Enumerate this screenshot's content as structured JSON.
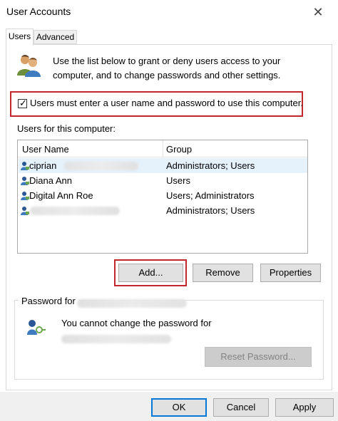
{
  "window": {
    "title": "User Accounts",
    "close_glyph": "✕"
  },
  "tabs": [
    {
      "label": "Users",
      "active": true
    },
    {
      "label": "Advanced",
      "active": false
    }
  ],
  "intro": {
    "text": "Use the list below to grant or deny users access to your computer, and to change passwords and other settings.",
    "icon": "users-icon"
  },
  "require_login": {
    "label": "Users must enter a user name and password to use this computer.",
    "checked": true,
    "check_glyph": "✓",
    "highlight_color": "#c0282d"
  },
  "user_list": {
    "caption": "Users for this computer:",
    "columns": {
      "name": "User Name",
      "group": "Group"
    },
    "rows": [
      {
        "name": "ciprian",
        "group": "Administrators; Users",
        "selected": true
      },
      {
        "name": "Diana Ann",
        "group": "Users",
        "selected": false
      },
      {
        "name": "Digital Ann Roe",
        "group": "Users; Administrators",
        "selected": false
      },
      {
        "name": "",
        "group": "Administrators; Users",
        "selected": false
      }
    ]
  },
  "buttons": {
    "add": "Add...",
    "remove": "Remove",
    "properties": "Properties"
  },
  "password_group": {
    "legend": "Password for",
    "message": "You cannot change the password for",
    "reset_label": "Reset Password...",
    "icon": "key-icon"
  },
  "footer": {
    "ok": "OK",
    "cancel": "Cancel",
    "apply": "Apply"
  },
  "colors": {
    "selection": "#e5f1fb",
    "highlight_box": "#c0282d",
    "default_button_border": "#0078d7"
  }
}
